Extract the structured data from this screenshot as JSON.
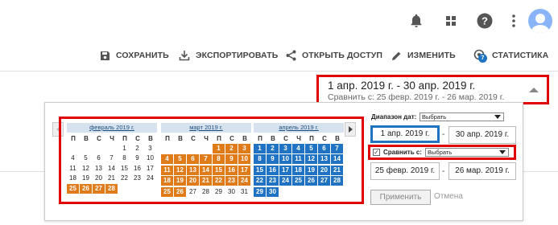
{
  "topbar": {
    "icons": [
      "bell-icon",
      "apps-grid-icon",
      "help-icon",
      "more-vert-icon",
      "avatar"
    ]
  },
  "toolbar": {
    "save": "СОХРАНИТЬ",
    "export": "ЭКСПОРТИРОВАТЬ",
    "share": "ОТКРЫТЬ ДОСТУП",
    "edit": "ИЗМЕНИТЬ",
    "stats": "СТАТИСТИКА",
    "stats_badge": "7"
  },
  "range_summary": {
    "main": "1 апр. 2019 г. - 30 апр. 2019 г.",
    "compare": "Сравнить с: 25 февр. 2019 г. - 26 мар. 2019 г."
  },
  "calendar": {
    "dows": [
      "П",
      "В",
      "С",
      "Ч",
      "П",
      "С",
      "В"
    ],
    "months": [
      {
        "title": "февраль 2019 г.",
        "weeks": [
          [
            {
              "d": "",
              "c": ""
            },
            {
              "d": "",
              "c": ""
            },
            {
              "d": "",
              "c": ""
            },
            {
              "d": "",
              "c": ""
            },
            {
              "d": "1",
              "c": ""
            },
            {
              "d": "2",
              "c": ""
            },
            {
              "d": "3",
              "c": ""
            }
          ],
          [
            {
              "d": "4",
              "c": ""
            },
            {
              "d": "5",
              "c": ""
            },
            {
              "d": "6",
              "c": ""
            },
            {
              "d": "7",
              "c": ""
            },
            {
              "d": "8",
              "c": ""
            },
            {
              "d": "9",
              "c": ""
            },
            {
              "d": "10",
              "c": ""
            }
          ],
          [
            {
              "d": "11",
              "c": ""
            },
            {
              "d": "12",
              "c": ""
            },
            {
              "d": "13",
              "c": ""
            },
            {
              "d": "14",
              "c": ""
            },
            {
              "d": "15",
              "c": ""
            },
            {
              "d": "16",
              "c": ""
            },
            {
              "d": "17",
              "c": ""
            }
          ],
          [
            {
              "d": "18",
              "c": ""
            },
            {
              "d": "19",
              "c": ""
            },
            {
              "d": "20",
              "c": ""
            },
            {
              "d": "21",
              "c": ""
            },
            {
              "d": "22",
              "c": ""
            },
            {
              "d": "23",
              "c": ""
            },
            {
              "d": "24",
              "c": ""
            }
          ],
          [
            {
              "d": "25",
              "c": "orange"
            },
            {
              "d": "26",
              "c": "orange"
            },
            {
              "d": "27",
              "c": "orange"
            },
            {
              "d": "28",
              "c": "orange"
            },
            {
              "d": "",
              "c": ""
            },
            {
              "d": "",
              "c": ""
            },
            {
              "d": "",
              "c": ""
            }
          ]
        ]
      },
      {
        "title": "март 2019 г.",
        "weeks": [
          [
            {
              "d": "",
              "c": ""
            },
            {
              "d": "",
              "c": ""
            },
            {
              "d": "",
              "c": ""
            },
            {
              "d": "",
              "c": ""
            },
            {
              "d": "1",
              "c": "orange"
            },
            {
              "d": "2",
              "c": "orange"
            },
            {
              "d": "3",
              "c": "orange"
            }
          ],
          [
            {
              "d": "4",
              "c": "orange"
            },
            {
              "d": "5",
              "c": "orange"
            },
            {
              "d": "6",
              "c": "orange"
            },
            {
              "d": "7",
              "c": "orange"
            },
            {
              "d": "8",
              "c": "orange"
            },
            {
              "d": "9",
              "c": "orange"
            },
            {
              "d": "10",
              "c": "orange"
            }
          ],
          [
            {
              "d": "11",
              "c": "orange"
            },
            {
              "d": "12",
              "c": "orange"
            },
            {
              "d": "13",
              "c": "orange"
            },
            {
              "d": "14",
              "c": "orange"
            },
            {
              "d": "15",
              "c": "orange"
            },
            {
              "d": "16",
              "c": "orange"
            },
            {
              "d": "17",
              "c": "orange"
            }
          ],
          [
            {
              "d": "18",
              "c": "orange"
            },
            {
              "d": "19",
              "c": "orange"
            },
            {
              "d": "20",
              "c": "orange"
            },
            {
              "d": "21",
              "c": "orange"
            },
            {
              "d": "22",
              "c": "orange"
            },
            {
              "d": "23",
              "c": "orange"
            },
            {
              "d": "24",
              "c": "orange"
            }
          ],
          [
            {
              "d": "25",
              "c": "orange"
            },
            {
              "d": "26",
              "c": "orange"
            },
            {
              "d": "27",
              "c": ""
            },
            {
              "d": "28",
              "c": ""
            },
            {
              "d": "29",
              "c": ""
            },
            {
              "d": "30",
              "c": ""
            },
            {
              "d": "31",
              "c": ""
            }
          ]
        ]
      },
      {
        "title": "апрель 2019 г.",
        "weeks": [
          [
            {
              "d": "1",
              "c": "blue"
            },
            {
              "d": "2",
              "c": "blue"
            },
            {
              "d": "3",
              "c": "blue"
            },
            {
              "d": "4",
              "c": "blue"
            },
            {
              "d": "5",
              "c": "blue"
            },
            {
              "d": "6",
              "c": "blue"
            },
            {
              "d": "7",
              "c": "blue"
            }
          ],
          [
            {
              "d": "8",
              "c": "blue"
            },
            {
              "d": "9",
              "c": "blue"
            },
            {
              "d": "10",
              "c": "blue"
            },
            {
              "d": "11",
              "c": "blue"
            },
            {
              "d": "12",
              "c": "blue"
            },
            {
              "d": "13",
              "c": "blue"
            },
            {
              "d": "14",
              "c": "blue"
            }
          ],
          [
            {
              "d": "15",
              "c": "blue"
            },
            {
              "d": "16",
              "c": "blue"
            },
            {
              "d": "17",
              "c": "blue"
            },
            {
              "d": "18",
              "c": "blue"
            },
            {
              "d": "19",
              "c": "blue"
            },
            {
              "d": "20",
              "c": "blue"
            },
            {
              "d": "21",
              "c": "blue"
            }
          ],
          [
            {
              "d": "22",
              "c": "blue"
            },
            {
              "d": "23",
              "c": "blue"
            },
            {
              "d": "24",
              "c": "blue"
            },
            {
              "d": "25",
              "c": "blue"
            },
            {
              "d": "26",
              "c": "blue"
            },
            {
              "d": "27",
              "c": "blue"
            },
            {
              "d": "28",
              "c": "blue"
            }
          ],
          [
            {
              "d": "29",
              "c": "blue"
            },
            {
              "d": "30",
              "c": "blue"
            },
            {
              "d": "",
              "c": ""
            },
            {
              "d": "",
              "c": ""
            },
            {
              "d": "",
              "c": ""
            },
            {
              "d": "",
              "c": ""
            },
            {
              "d": "",
              "c": ""
            }
          ]
        ]
      }
    ]
  },
  "controls": {
    "range_label": "Диапазон дат:",
    "range_select": "Выбрать",
    "start": "1 апр. 2019 г.",
    "end": "30 апр. 2019 г.",
    "dash": "-",
    "compare_checked": true,
    "compare_label": "Сравнить с:",
    "compare_select": "Выбрать",
    "cmp_start": "25 февр. 2019 г.",
    "cmp_end": "26 мар. 2019 г.",
    "apply": "Применить",
    "cancel": "Отмена"
  },
  "colors": {
    "accent_blue": "#1f73c2",
    "compare_orange": "#e07b1a",
    "annotation_red": "#e00000"
  }
}
